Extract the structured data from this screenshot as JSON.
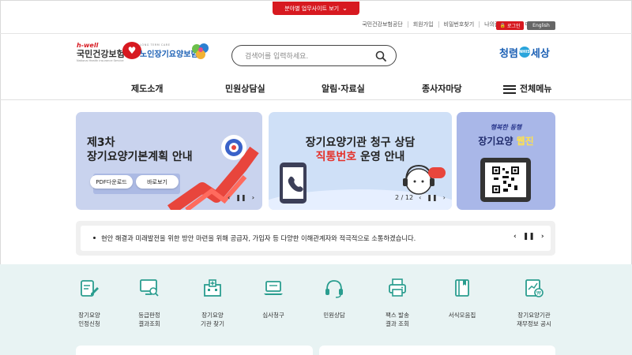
{
  "top_bar": {
    "label": "분야별 업무사이트 보기"
  },
  "util_links": [
    "국민건강보험공단",
    "회원가입",
    "비밀번호찾기",
    "나의즐겨찾기",
    "마이페이지"
  ],
  "login_label": "로그인",
  "english_label": "English",
  "logo_nhis": {
    "tag": "h-well",
    "name": "국민건강보험",
    "sub": "National Health Insurance Service"
  },
  "logo_ltc": {
    "en": "LONG TERM CARE",
    "name": "노인장기요양보험"
  },
  "search": {
    "placeholder": "검색어를 입력하세요."
  },
  "brand_right": {
    "left": "청렴",
    "right": "세상",
    "dot": "NHIS"
  },
  "nav": [
    "제도소개",
    "민원상담실",
    "알림·자료실",
    "종사자마당"
  ],
  "nav_menu_label": "전체메뉴",
  "banner1": {
    "line1": "제3차",
    "line2": "장기요양기본계획 안내",
    "pdf_label": "PDF다운로드",
    "view_label": "바로보기"
  },
  "banner2": {
    "line1": "장기요양기관 청구 상담",
    "line2_red": "직통번호",
    "line2_rest": " 운영 안내",
    "pager": "2 / 12"
  },
  "banner3": {
    "line1": "행복한 동행",
    "line2_a": "장기요양 ",
    "line2_b": "웹진"
  },
  "notice": {
    "text": "현안 해결과 미래발전을 위한 방안 마련을 위해 공급자, 가입자 등 다양한 이해관계자와 적극적으로 소통하겠습니다."
  },
  "quick_links": [
    {
      "label1": "장기요양",
      "label2": "인정신청"
    },
    {
      "label1": "등급판정",
      "label2": "결과조회"
    },
    {
      "label1": "장기요양",
      "label2": "기관 찾기"
    },
    {
      "label1": "심사청구",
      "label2": ""
    },
    {
      "label1": "민원상담",
      "label2": ""
    },
    {
      "label1": "팩스 발송",
      "label2": "결과 조회"
    },
    {
      "label1": "서식모음집",
      "label2": ""
    },
    {
      "label1": "장기요양기관",
      "label2": "재무정보 공시"
    }
  ],
  "colors": {
    "brand_red": "#d71920",
    "brand_blue": "#1a5fb4",
    "teal": "#2a9d8f",
    "quick_bg": "#e8f3f3"
  }
}
